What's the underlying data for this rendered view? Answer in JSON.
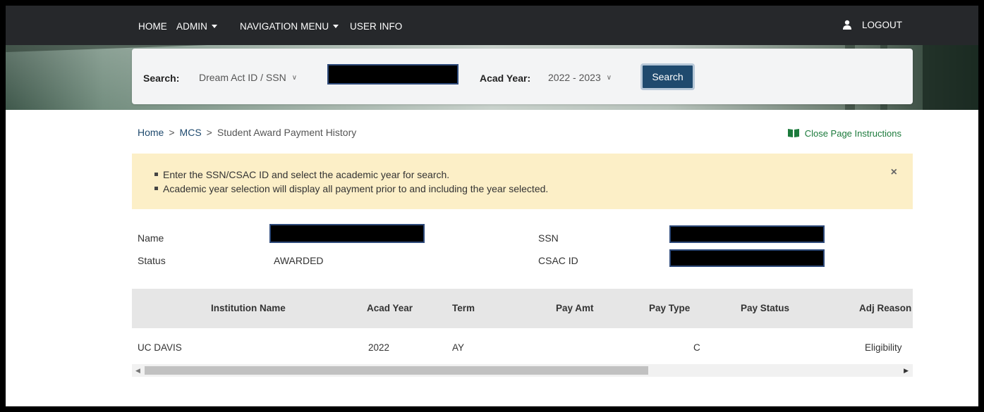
{
  "nav": {
    "home": "HOME",
    "admin": "ADMIN",
    "navigation_menu": "NAVIGATION MENU",
    "user_info": "USER INFO",
    "logout": "LOGOUT"
  },
  "search": {
    "label": "Search:",
    "type_selected": "Dream Act ID / SSN",
    "acad_year_label": "Acad Year:",
    "acad_year_selected": "2022 - 2023",
    "button_label": "Search"
  },
  "breadcrumb": {
    "home": "Home",
    "mcs": "MCS",
    "current": "Student Award Payment History",
    "separator": ">"
  },
  "page_instructions_toggle": "Close Page Instructions",
  "instructions": {
    "items": [
      "Enter the SSN/CSAC ID and select the academic year for search.",
      "Academic year selection will display all payment prior to and including the year selected."
    ],
    "close": "×"
  },
  "student": {
    "name_label": "Name",
    "status_label": "Status",
    "status_value": "AWARDED",
    "ssn_label": "SSN",
    "csac_id_label": "CSAC ID"
  },
  "table": {
    "headers": [
      "Institution Name",
      "Acad Year",
      "Term",
      "Pay Amt",
      "Pay Type",
      "Pay Status",
      "Adj Reason"
    ],
    "rows": [
      [
        "UC DAVIS",
        "2022",
        "AY",
        "",
        "C",
        "",
        "Eligibility"
      ]
    ]
  },
  "colors": {
    "nav_bg": "#26282b",
    "primary_button": "#1f4a6e",
    "link": "#1f4a6e",
    "instructions_bg": "#fcefc7",
    "instructions_toggle": "#1b7a3b",
    "table_header_bg": "#e6e6e6"
  }
}
